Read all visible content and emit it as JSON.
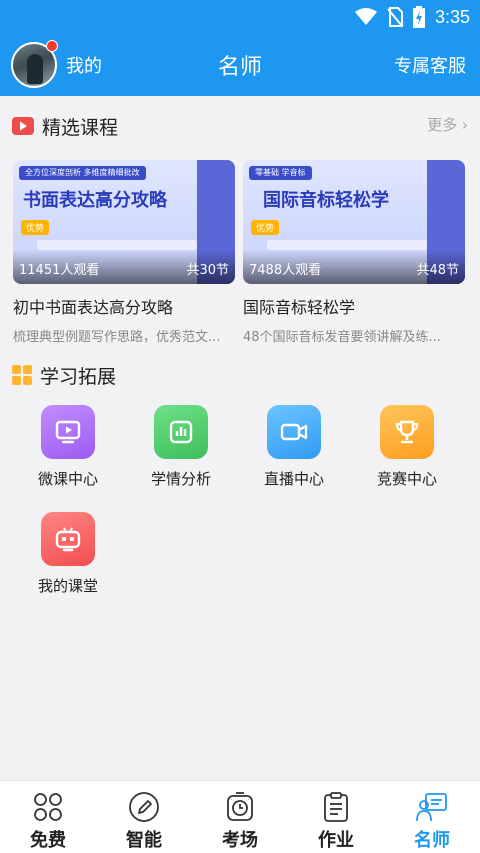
{
  "status_bar": {
    "time": "3:35"
  },
  "header": {
    "me_label": "我的",
    "title": "名师",
    "service_label": "专属客服"
  },
  "featured": {
    "section_title": "精选课程",
    "more_label": "更多 ›",
    "courses": [
      {
        "thumb_tag": "全方位深度剖析  多维度精细批改",
        "thumb_title": "书面表达高分攻略",
        "thumb_badge": "优势",
        "views": "11451人观看",
        "lessons": "共30节",
        "title": "初中书面表达高分攻略",
        "desc": "梳理典型例题写作思路，优秀范文..."
      },
      {
        "thumb_tag": "零基础 学音标",
        "thumb_title": "国际音标轻松学",
        "thumb_badge": "优势",
        "views": "7488人观看",
        "lessons": "共48节",
        "title": "国际音标轻松学",
        "desc": "48个国际音标发音要领讲解及练..."
      }
    ]
  },
  "extension": {
    "section_title": "学习拓展",
    "tools": [
      {
        "label": "微课中心",
        "icon": "video-screen-icon",
        "color": "#a86bf5"
      },
      {
        "label": "学情分析",
        "icon": "bar-chart-icon",
        "color": "#4ccd6a"
      },
      {
        "label": "直播中心",
        "icon": "camera-icon",
        "color": "#3aa8f6"
      },
      {
        "label": "竞赛中心",
        "icon": "trophy-icon",
        "color": "#ffab2c"
      },
      {
        "label": "我的课堂",
        "icon": "classroom-robot-icon",
        "color": "#f46060"
      }
    ]
  },
  "tabbar": {
    "tabs": [
      {
        "label": "免费",
        "icon": "clover-icon"
      },
      {
        "label": "智能",
        "icon": "pen-icon"
      },
      {
        "label": "考场",
        "icon": "timer-icon"
      },
      {
        "label": "作业",
        "icon": "clipboard-icon"
      },
      {
        "label": "名师",
        "icon": "teacher-icon",
        "active": true
      }
    ]
  },
  "colors": {
    "primary": "#1e97f0",
    "badge_red": "#f23a2a"
  }
}
